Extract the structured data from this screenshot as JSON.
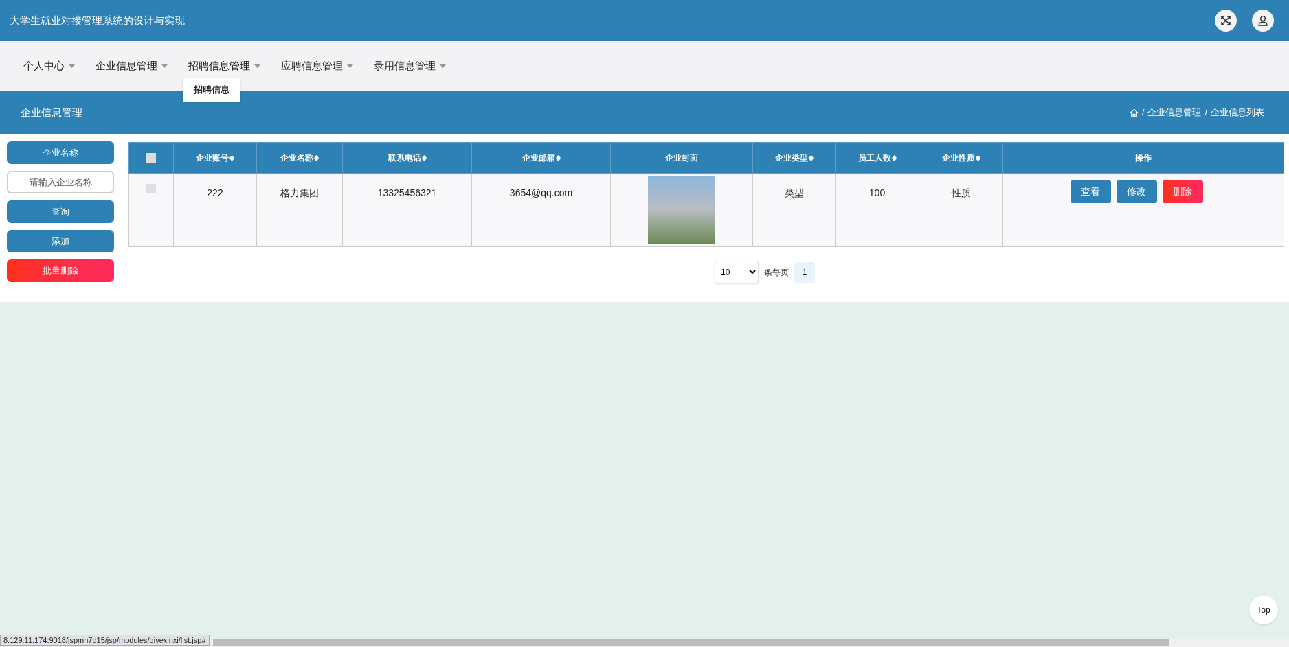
{
  "header": {
    "title": "大学生就业对接管理系统的设计与实现"
  },
  "nav": [
    {
      "label": "个人中心",
      "expanded": false
    },
    {
      "label": "企业信息管理",
      "expanded": false
    },
    {
      "label": "招聘信息管理",
      "expanded": true,
      "menu": [
        "招聘信息"
      ]
    },
    {
      "label": "应聘信息管理",
      "expanded": false
    },
    {
      "label": "录用信息管理",
      "expanded": false
    }
  ],
  "page_title": "企业信息管理",
  "breadcrumb": [
    {
      "separator": "/",
      "label": "企业信息管理"
    },
    {
      "separator": "/",
      "label": "企业信息列表"
    }
  ],
  "sidebar": {
    "label": "企业名称",
    "search_placeholder": "请输入企业名称",
    "buttons": [
      {
        "label": "查询",
        "kind": "primary"
      },
      {
        "label": "添加",
        "kind": "primary"
      },
      {
        "label": "批量删除",
        "kind": "danger"
      }
    ]
  },
  "table": {
    "select_all_checked": false,
    "columns": [
      {
        "label": "企业账号",
        "sortable": true
      },
      {
        "label": "企业名称",
        "sortable": true
      },
      {
        "label": "联系电话",
        "sortable": true
      },
      {
        "label": "企业邮箱",
        "sortable": true
      },
      {
        "label": "企业封面",
        "sortable": false
      },
      {
        "label": "企业类型",
        "sortable": true
      },
      {
        "label": "员工人数",
        "sortable": true
      },
      {
        "label": "企业性质",
        "sortable": true
      },
      {
        "label": "操作",
        "sortable": false
      }
    ],
    "rows": [
      {
        "checked": false,
        "cells": [
          "222",
          "格力集团",
          "13325456321",
          "3654@qq.com",
          null,
          "类型",
          "100",
          "性质"
        ],
        "actions": [
          {
            "label": "查看",
            "kind": "primary"
          },
          {
            "label": "修改",
            "kind": "primary"
          },
          {
            "label": "删除",
            "kind": "danger"
          }
        ]
      }
    ]
  },
  "pagination": {
    "page_size": "10",
    "page_size_label": "条每页",
    "pages": [
      {
        "label": "1",
        "selected": true
      }
    ]
  },
  "top_button": "Top",
  "status_bar": "8.129.11.174:9018/jspmn7d15/jsp/modules/qiyexinxi/list.jsp#"
}
